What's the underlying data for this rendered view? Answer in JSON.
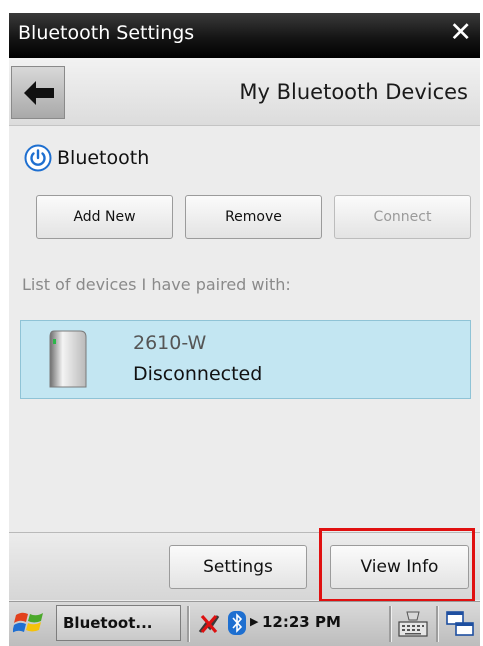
{
  "window": {
    "title": "Bluetooth Settings",
    "close_glyph": "✕"
  },
  "header": {
    "back_icon": "back-arrow-icon",
    "title": "My Bluetooth Devices"
  },
  "bluetooth": {
    "icon": "power-icon",
    "label": "Bluetooth"
  },
  "buttons": {
    "add_new": "Add New",
    "remove": "Remove",
    "connect": "Connect"
  },
  "list_label": "List of devices I have paired with:",
  "devices": [
    {
      "name": "2610-W",
      "status": "Disconnected",
      "icon": "device-icon"
    }
  ],
  "bottom": {
    "settings": "Settings",
    "view_info": "View Info"
  },
  "taskbar": {
    "start_icon": "windows-flag-icon",
    "app_label": "Bluetoot...",
    "arrow_glyph": "▶",
    "clock": "12:23 PM",
    "colors": {
      "highlight": "#e01010",
      "device_bg": "#c3e6f2",
      "accent": "#1e6fd0"
    }
  }
}
